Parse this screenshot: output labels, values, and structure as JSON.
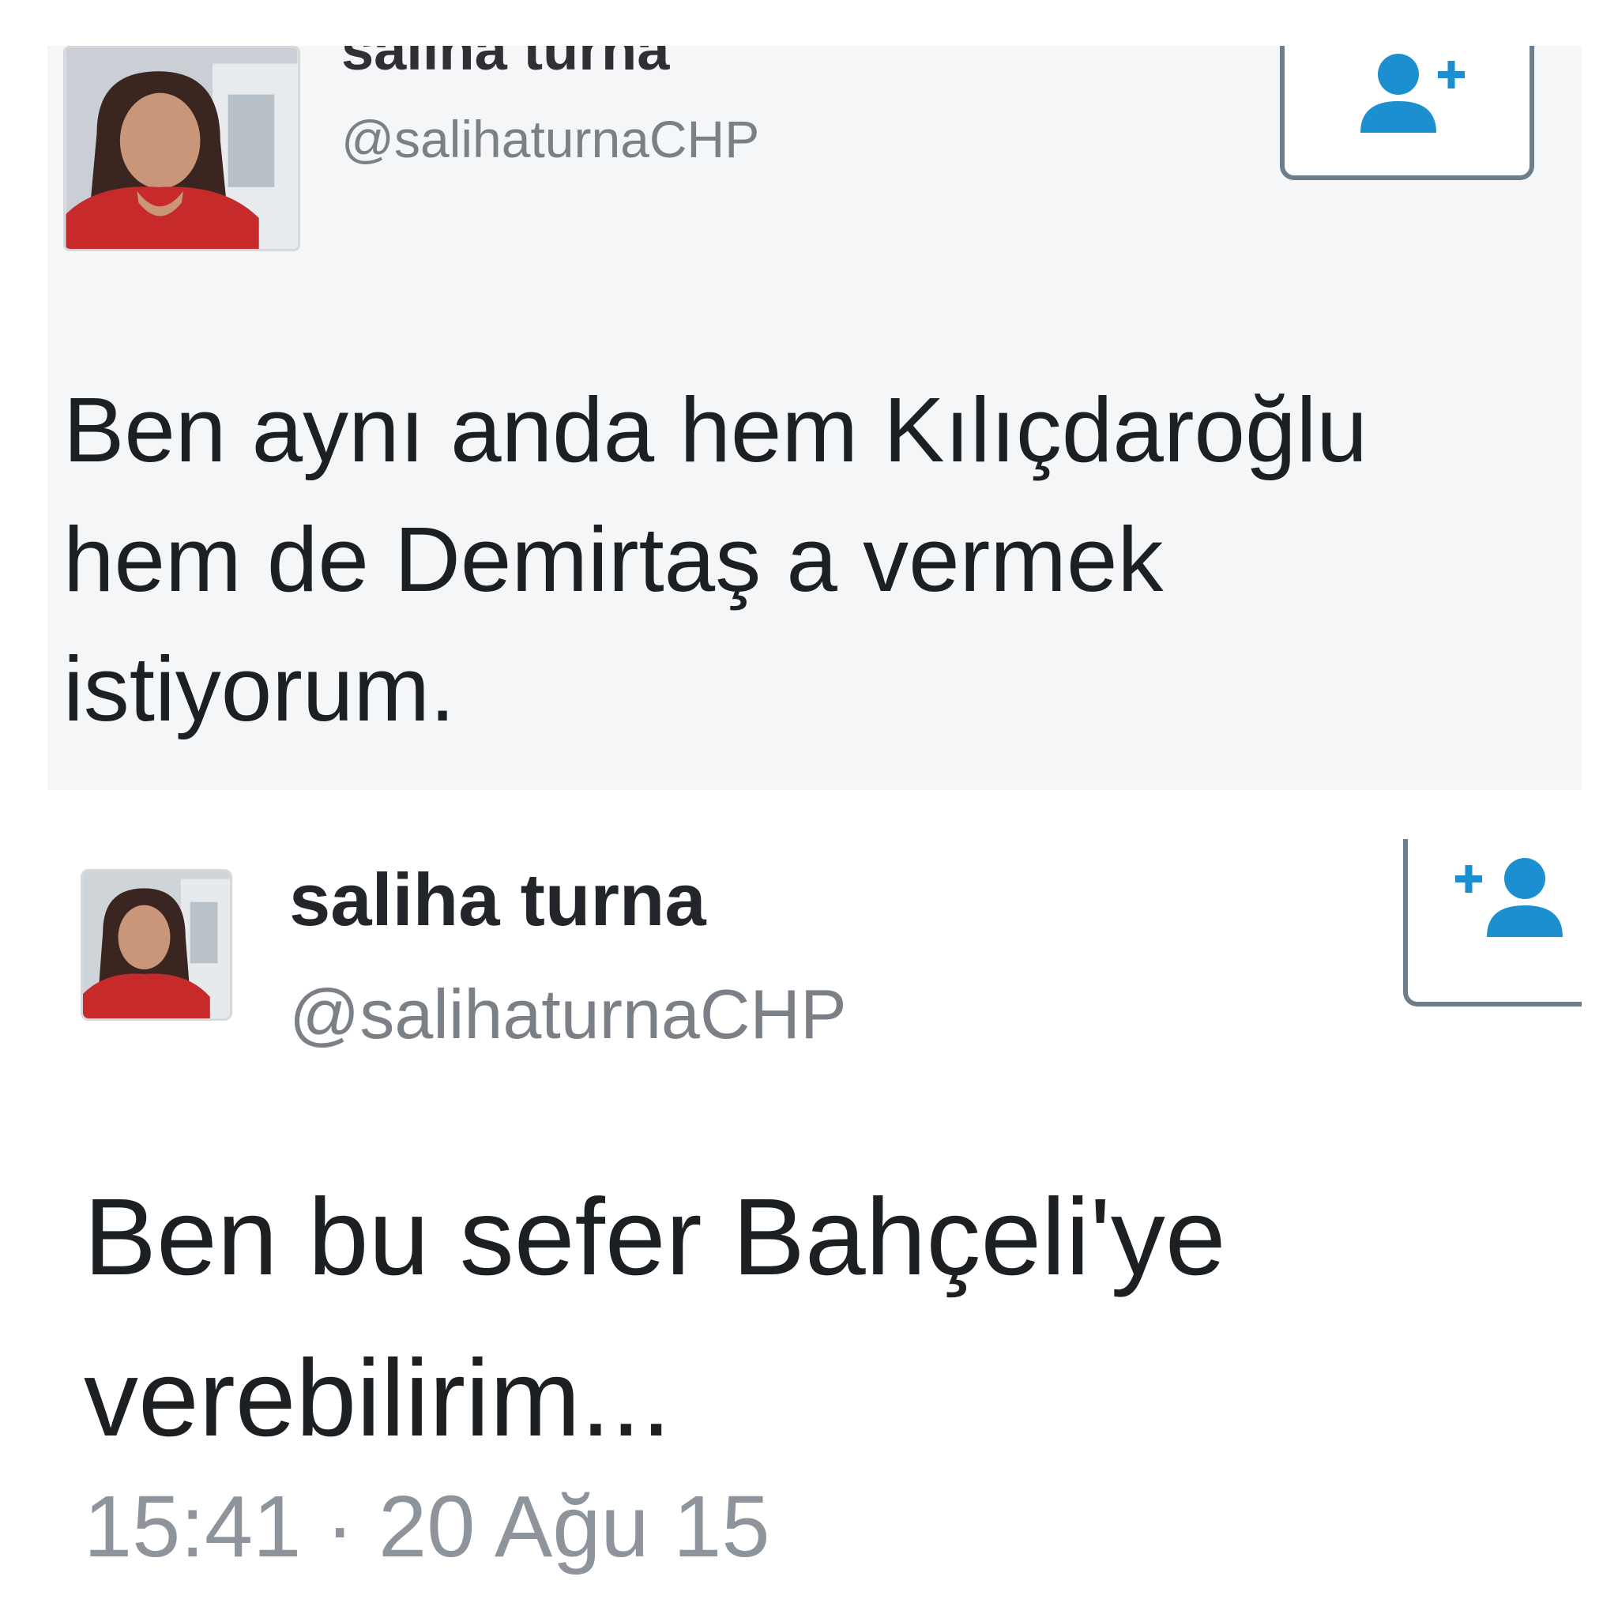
{
  "tweets": [
    {
      "name": "saliha turna",
      "handle": "@salihaturnaCHP",
      "text": "Ben aynı anda hem Kılıçdaroğlu\nhem de Demirtaş a vermek\nistiyorum.",
      "avatar_icon": "profile-photo",
      "follow_icon": "follow-user-icon"
    },
    {
      "name": "saliha turna",
      "handle": "@salihaturnaCHP",
      "text": "Ben bu sefer Bahçeli'ye\nverebilirim...",
      "timestamp": "15:41 · 20 Ağu 15",
      "avatar_icon": "profile-photo",
      "follow_icon": "follow-user-icon"
    }
  ],
  "colors": {
    "accent_blue": "#1b8fd0",
    "button_border": "#6d7d8a",
    "text": "#1d2023",
    "muted": "#8d949b"
  }
}
